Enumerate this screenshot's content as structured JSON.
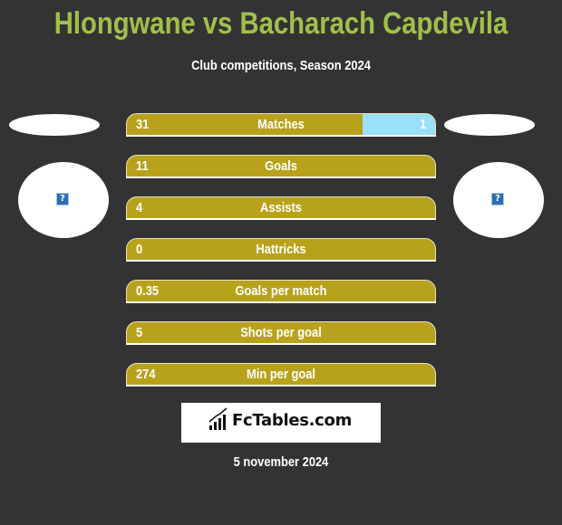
{
  "header": {
    "title": "Hlongwane vs Bacharach Capdevila",
    "subtitle": "Club competitions, Season 2024"
  },
  "players": {
    "left": {
      "name": "Hlongwane",
      "image_icon": "missing-image-icon",
      "placeholder_glyph": "?"
    },
    "right": {
      "name": "Bacharach Capdevila",
      "image_icon": "missing-image-icon",
      "placeholder_glyph": "?"
    }
  },
  "colors": {
    "title": "#a0c04a",
    "left_bar": "#b8a21c",
    "right_bar": "#99e0f8",
    "background": "#333333"
  },
  "stats": [
    {
      "label": "Matches",
      "left": "31",
      "right": "1",
      "right_share": 0.235
    },
    {
      "label": "Goals",
      "left": "11",
      "right": "",
      "right_share": 0
    },
    {
      "label": "Assists",
      "left": "4",
      "right": "",
      "right_share": 0
    },
    {
      "label": "Hattricks",
      "left": "0",
      "right": "",
      "right_share": 0
    },
    {
      "label": "Goals per match",
      "left": "0.35",
      "right": "",
      "right_share": 0
    },
    {
      "label": "Shots per goal",
      "left": "5",
      "right": "",
      "right_share": 0
    },
    {
      "label": "Min per goal",
      "left": "274",
      "right": "",
      "right_share": 0
    }
  ],
  "footer": {
    "logo_text": "FcTables.com",
    "logo_icon": "bar-chart-icon",
    "date": "5 november 2024"
  }
}
